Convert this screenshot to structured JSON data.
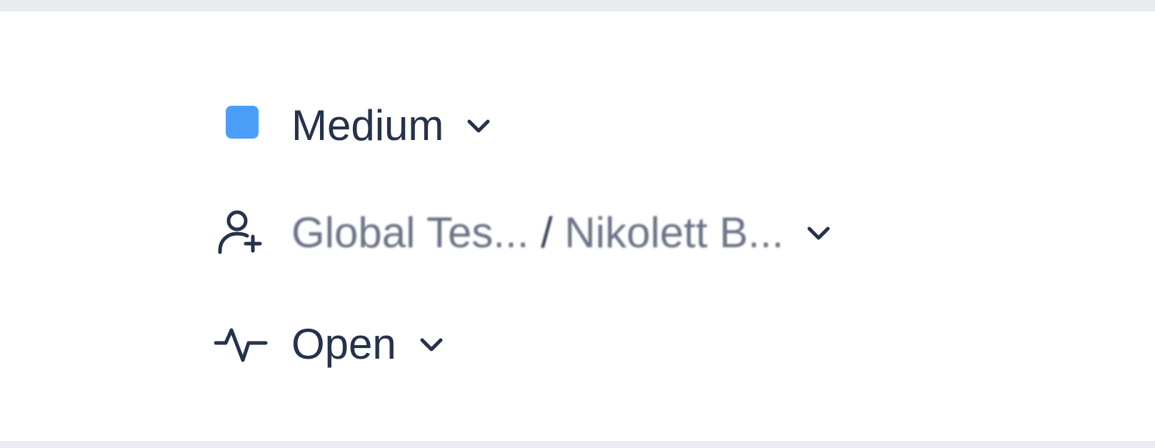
{
  "ticket": {
    "priority": {
      "label": "Medium",
      "color": "#4b9ef8",
      "icon": "priority-square-icon"
    },
    "assignee": {
      "group": "Global Tes...",
      "separator": "/",
      "agent": "Nikolett B...",
      "icon": "user-add-icon"
    },
    "status": {
      "label": "Open",
      "icon": "activity-icon"
    }
  },
  "icons": {
    "dropdown": "chevron-down-icon"
  }
}
